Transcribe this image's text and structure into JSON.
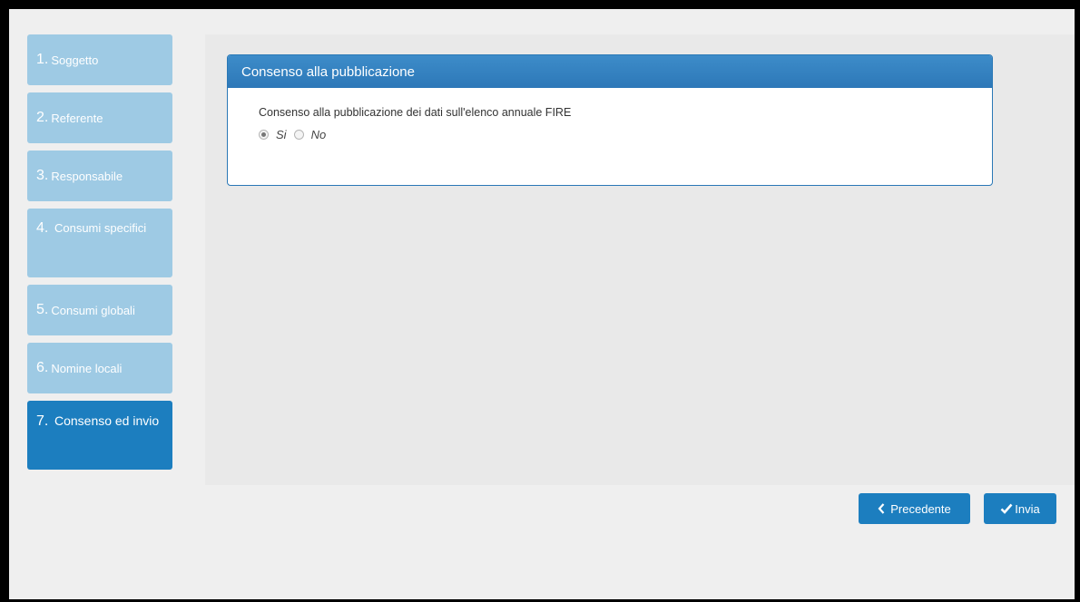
{
  "steps": [
    {
      "num": "1.",
      "label": "Soggetto"
    },
    {
      "num": "2.",
      "label": "Referente"
    },
    {
      "num": "3.",
      "label": "Responsabile"
    },
    {
      "num": "4.",
      "label": "Consumi specifici"
    },
    {
      "num": "5.",
      "label": "Consumi globali"
    },
    {
      "num": "6.",
      "label": "Nomine locali"
    },
    {
      "num": "7.",
      "label": "Consenso ed invio"
    }
  ],
  "active_step": 7,
  "panel": {
    "title": "Consenso alla pubblicazione",
    "question": "Consenso alla pubblicazione dei dati sull'elenco annuale FIRE",
    "options": [
      "Si",
      "No"
    ],
    "selected": "Si"
  },
  "buttons": {
    "prev": "Precedente",
    "submit": "Invia"
  },
  "colors": {
    "step_inactive": "#9ecae4",
    "step_active": "#1c7ebf",
    "panel_header": "#2d78b8",
    "button": "#1c7ebf"
  },
  "icons": {
    "prev": "chevron-left-icon",
    "submit": "check-icon"
  }
}
